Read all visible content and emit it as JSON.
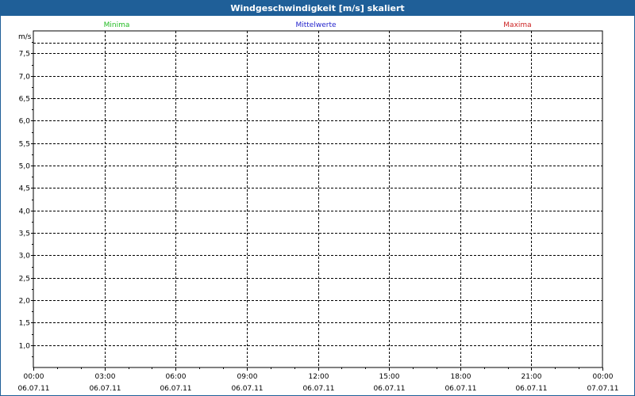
{
  "window": {
    "title": "Windgeschwindigkeit [m/s] skaliert"
  },
  "colors": {
    "titlebar_bg": "#1f5f98",
    "minima": "#22bb22",
    "mittelwerte": "#2222cc",
    "maxima": "#cc2222",
    "grid": "#000000"
  },
  "chart_data": {
    "type": "line",
    "title": "Windgeschwindigkeit [m/s] skaliert",
    "ylabel": "m/s",
    "xlabel": "",
    "legend_position": "top",
    "grid": true,
    "ylim": [
      0.5,
      8.0
    ],
    "y_ticks": [
      "1,0",
      "1,5",
      "2,0",
      "2,5",
      "3,0",
      "3,5",
      "4,0",
      "4,5",
      "5,0",
      "5,5",
      "6,0",
      "6,5",
      "7,0",
      "7,5"
    ],
    "y_tick_values": [
      1.0,
      1.5,
      2.0,
      2.5,
      3.0,
      3.5,
      4.0,
      4.5,
      5.0,
      5.5,
      6.0,
      6.5,
      7.0,
      7.5
    ],
    "x_ticks_time": [
      "00:00",
      "03:00",
      "06:00",
      "09:00",
      "12:00",
      "15:00",
      "18:00",
      "21:00",
      "00:00"
    ],
    "x_ticks_date": [
      "06.07.11",
      "06.07.11",
      "06.07.11",
      "06.07.11",
      "06.07.11",
      "06.07.11",
      "06.07.11",
      "06.07.11",
      "07.07.11"
    ],
    "series": [
      {
        "name": "Minima",
        "color": "#22bb22",
        "values": []
      },
      {
        "name": "Mittelwerte",
        "color": "#2222cc",
        "values": []
      },
      {
        "name": "Maxima",
        "color": "#cc2222",
        "values": []
      }
    ]
  }
}
